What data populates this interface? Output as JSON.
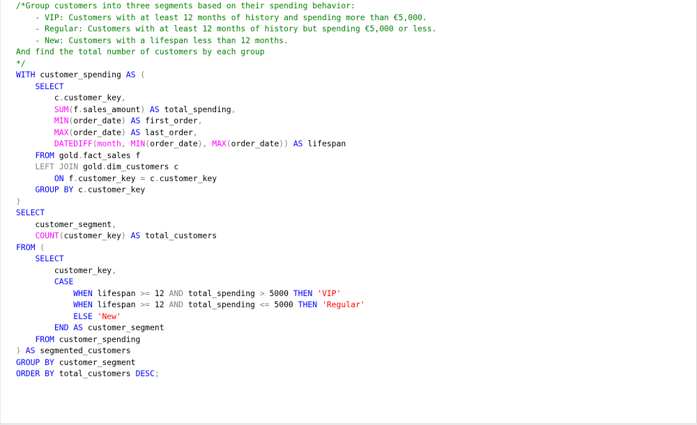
{
  "colors": {
    "keyword": "#0000ff",
    "function": "#ff00ff",
    "operator": "#808080",
    "string": "#ff0000",
    "comment": "#008000",
    "text": "#000000"
  },
  "lines": [
    [
      {
        "t": "/*Group customers into three segments based on their spending behavior:",
        "c": "cm"
      }
    ],
    [
      {
        "t": "    - VIP: Customers with at least 12 months of history and spending more than €5,000.",
        "c": "cm"
      }
    ],
    [
      {
        "t": "    - Regular: Customers with at least 12 months of history but spending €5,000 or less.",
        "c": "cm"
      }
    ],
    [
      {
        "t": "    - New: Customers with a lifespan less than 12 months.",
        "c": "cm"
      }
    ],
    [
      {
        "t": "And find the total number of customers by each group",
        "c": "cm"
      }
    ],
    [
      {
        "t": "*/",
        "c": "cm"
      }
    ],
    [
      {
        "t": "WITH",
        "c": "kw"
      },
      {
        "t": " customer_spending ",
        "c": "plain"
      },
      {
        "t": "AS",
        "c": "kw"
      },
      {
        "t": " (",
        "c": "op"
      }
    ],
    [
      {
        "t": "    ",
        "c": "plain"
      },
      {
        "t": "SELECT",
        "c": "kw"
      }
    ],
    [
      {
        "t": "        c",
        "c": "plain"
      },
      {
        "t": ".",
        "c": "op"
      },
      {
        "t": "customer_key",
        "c": "plain"
      },
      {
        "t": ",",
        "c": "op"
      }
    ],
    [
      {
        "t": "        ",
        "c": "plain"
      },
      {
        "t": "SUM",
        "c": "fn"
      },
      {
        "t": "(",
        "c": "op"
      },
      {
        "t": "f",
        "c": "plain"
      },
      {
        "t": ".",
        "c": "op"
      },
      {
        "t": "sales_amount",
        "c": "plain"
      },
      {
        "t": ")",
        "c": "op"
      },
      {
        "t": " ",
        "c": "plain"
      },
      {
        "t": "AS",
        "c": "kw"
      },
      {
        "t": " total_spending",
        "c": "plain"
      },
      {
        "t": ",",
        "c": "op"
      }
    ],
    [
      {
        "t": "        ",
        "c": "plain"
      },
      {
        "t": "MIN",
        "c": "fn"
      },
      {
        "t": "(",
        "c": "op"
      },
      {
        "t": "order_date",
        "c": "plain"
      },
      {
        "t": ")",
        "c": "op"
      },
      {
        "t": " ",
        "c": "plain"
      },
      {
        "t": "AS",
        "c": "kw"
      },
      {
        "t": " first_order",
        "c": "plain"
      },
      {
        "t": ",",
        "c": "op"
      }
    ],
    [
      {
        "t": "        ",
        "c": "plain"
      },
      {
        "t": "MAX",
        "c": "fn"
      },
      {
        "t": "(",
        "c": "op"
      },
      {
        "t": "order_date",
        "c": "plain"
      },
      {
        "t": ")",
        "c": "op"
      },
      {
        "t": " ",
        "c": "plain"
      },
      {
        "t": "AS",
        "c": "kw"
      },
      {
        "t": " last_order",
        "c": "plain"
      },
      {
        "t": ",",
        "c": "op"
      }
    ],
    [
      {
        "t": "        ",
        "c": "plain"
      },
      {
        "t": "DATEDIFF",
        "c": "fn"
      },
      {
        "t": "(",
        "c": "op"
      },
      {
        "t": "month",
        "c": "fn"
      },
      {
        "t": ", ",
        "c": "op"
      },
      {
        "t": "MIN",
        "c": "fn"
      },
      {
        "t": "(",
        "c": "op"
      },
      {
        "t": "order_date",
        "c": "plain"
      },
      {
        "t": "), ",
        "c": "op"
      },
      {
        "t": "MAX",
        "c": "fn"
      },
      {
        "t": "(",
        "c": "op"
      },
      {
        "t": "order_date",
        "c": "plain"
      },
      {
        "t": "))",
        "c": "op"
      },
      {
        "t": " ",
        "c": "plain"
      },
      {
        "t": "AS",
        "c": "kw"
      },
      {
        "t": " lifespan",
        "c": "plain"
      }
    ],
    [
      {
        "t": "    ",
        "c": "plain"
      },
      {
        "t": "FROM",
        "c": "kw"
      },
      {
        "t": " gold",
        "c": "plain"
      },
      {
        "t": ".",
        "c": "op"
      },
      {
        "t": "fact_sales f",
        "c": "plain"
      }
    ],
    [
      {
        "t": "    ",
        "c": "plain"
      },
      {
        "t": "LEFT JOIN",
        "c": "op"
      },
      {
        "t": " gold",
        "c": "plain"
      },
      {
        "t": ".",
        "c": "op"
      },
      {
        "t": "dim_customers c",
        "c": "plain"
      }
    ],
    [
      {
        "t": "        ",
        "c": "plain"
      },
      {
        "t": "ON",
        "c": "kw"
      },
      {
        "t": " f",
        "c": "plain"
      },
      {
        "t": ".",
        "c": "op"
      },
      {
        "t": "customer_key ",
        "c": "plain"
      },
      {
        "t": "=",
        "c": "op"
      },
      {
        "t": " c",
        "c": "plain"
      },
      {
        "t": ".",
        "c": "op"
      },
      {
        "t": "customer_key",
        "c": "plain"
      }
    ],
    [
      {
        "t": "    ",
        "c": "plain"
      },
      {
        "t": "GROUP BY",
        "c": "kw"
      },
      {
        "t": " c",
        "c": "plain"
      },
      {
        "t": ".",
        "c": "op"
      },
      {
        "t": "customer_key",
        "c": "plain"
      }
    ],
    [
      {
        "t": ")",
        "c": "op"
      }
    ],
    [
      {
        "t": "SELECT",
        "c": "kw"
      }
    ],
    [
      {
        "t": "    customer_segment",
        "c": "plain"
      },
      {
        "t": ",",
        "c": "op"
      }
    ],
    [
      {
        "t": "    ",
        "c": "plain"
      },
      {
        "t": "COUNT",
        "c": "fn"
      },
      {
        "t": "(",
        "c": "op"
      },
      {
        "t": "customer_key",
        "c": "plain"
      },
      {
        "t": ")",
        "c": "op"
      },
      {
        "t": " ",
        "c": "plain"
      },
      {
        "t": "AS",
        "c": "kw"
      },
      {
        "t": " total_customers",
        "c": "plain"
      }
    ],
    [
      {
        "t": "FROM",
        "c": "kw"
      },
      {
        "t": " (",
        "c": "op"
      }
    ],
    [
      {
        "t": "    ",
        "c": "plain"
      },
      {
        "t": "SELECT",
        "c": "kw"
      }
    ],
    [
      {
        "t": "        customer_key",
        "c": "plain"
      },
      {
        "t": ",",
        "c": "op"
      }
    ],
    [
      {
        "t": "        ",
        "c": "plain"
      },
      {
        "t": "CASE",
        "c": "kw"
      }
    ],
    [
      {
        "t": "            ",
        "c": "plain"
      },
      {
        "t": "WHEN",
        "c": "kw"
      },
      {
        "t": " lifespan ",
        "c": "plain"
      },
      {
        "t": ">=",
        "c": "op"
      },
      {
        "t": " 12 ",
        "c": "plain"
      },
      {
        "t": "AND",
        "c": "op"
      },
      {
        "t": " total_spending ",
        "c": "plain"
      },
      {
        "t": ">",
        "c": "op"
      },
      {
        "t": " 5000 ",
        "c": "plain"
      },
      {
        "t": "THEN",
        "c": "kw"
      },
      {
        "t": " ",
        "c": "plain"
      },
      {
        "t": "'VIP'",
        "c": "str"
      }
    ],
    [
      {
        "t": "            ",
        "c": "plain"
      },
      {
        "t": "WHEN",
        "c": "kw"
      },
      {
        "t": " lifespan ",
        "c": "plain"
      },
      {
        "t": ">=",
        "c": "op"
      },
      {
        "t": " 12 ",
        "c": "plain"
      },
      {
        "t": "AND",
        "c": "op"
      },
      {
        "t": " total_spending ",
        "c": "plain"
      },
      {
        "t": "<=",
        "c": "op"
      },
      {
        "t": " 5000 ",
        "c": "plain"
      },
      {
        "t": "THEN",
        "c": "kw"
      },
      {
        "t": " ",
        "c": "plain"
      },
      {
        "t": "'Regular'",
        "c": "str"
      }
    ],
    [
      {
        "t": "            ",
        "c": "plain"
      },
      {
        "t": "ELSE",
        "c": "kw"
      },
      {
        "t": " ",
        "c": "plain"
      },
      {
        "t": "'New'",
        "c": "str"
      }
    ],
    [
      {
        "t": "        ",
        "c": "plain"
      },
      {
        "t": "END",
        "c": "kw"
      },
      {
        "t": " ",
        "c": "plain"
      },
      {
        "t": "AS",
        "c": "kw"
      },
      {
        "t": " customer_segment",
        "c": "plain"
      }
    ],
    [
      {
        "t": "    ",
        "c": "plain"
      },
      {
        "t": "FROM",
        "c": "kw"
      },
      {
        "t": " customer_spending",
        "c": "plain"
      }
    ],
    [
      {
        "t": ")",
        "c": "op"
      },
      {
        "t": " ",
        "c": "plain"
      },
      {
        "t": "AS",
        "c": "kw"
      },
      {
        "t": " segmented_customers",
        "c": "plain"
      }
    ],
    [
      {
        "t": "GROUP BY",
        "c": "kw"
      },
      {
        "t": " customer_segment",
        "c": "plain"
      }
    ],
    [
      {
        "t": "ORDER BY",
        "c": "kw"
      },
      {
        "t": " total_customers ",
        "c": "plain"
      },
      {
        "t": "DESC",
        "c": "kw"
      },
      {
        "t": ";",
        "c": "op"
      }
    ]
  ]
}
